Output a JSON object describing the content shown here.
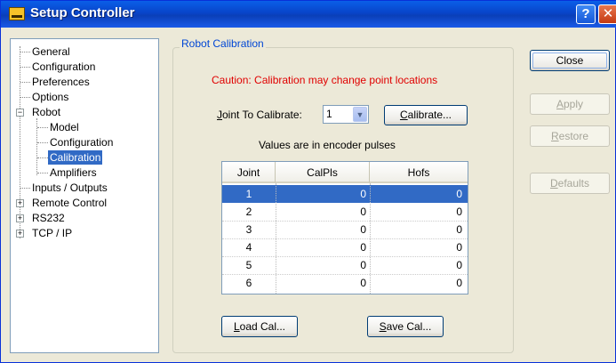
{
  "window": {
    "title": "Setup Controller",
    "help_glyph": "?",
    "close_glyph": "✕"
  },
  "tree": [
    {
      "label": "General",
      "level": 1,
      "selected": false
    },
    {
      "label": "Configuration",
      "level": 1,
      "selected": false
    },
    {
      "label": "Preferences",
      "level": 1,
      "selected": false
    },
    {
      "label": "Options",
      "level": 1,
      "selected": false
    },
    {
      "label": "Robot",
      "level": 1,
      "selected": false,
      "expander": "−"
    },
    {
      "label": "Model",
      "level": 2,
      "selected": false
    },
    {
      "label": "Configuration",
      "level": 2,
      "selected": false
    },
    {
      "label": "Calibration",
      "level": 2,
      "selected": true
    },
    {
      "label": "Amplifiers",
      "level": 2,
      "selected": false
    },
    {
      "label": "Inputs / Outputs",
      "level": 1,
      "selected": false
    },
    {
      "label": "Remote Control",
      "level": 1,
      "selected": false,
      "expander": "+"
    },
    {
      "label": "RS232",
      "level": 1,
      "selected": false,
      "expander": "+"
    },
    {
      "label": "TCP / IP",
      "level": 1,
      "selected": false,
      "expander": "+"
    }
  ],
  "group": {
    "title": "Robot Calibration",
    "caution": "Caution: Calibration may change point locations",
    "joint_label_pre": "",
    "joint_label_key": "J",
    "joint_label_post": "oint To Calibrate:",
    "joint_value": "1",
    "calibrate_key": "C",
    "calibrate_rest": "alibrate...",
    "values_note": "Values are in encoder pulses",
    "load_key": "L",
    "load_rest": "oad Cal...",
    "save_key": "S",
    "save_rest": "ave Cal..."
  },
  "table": {
    "headers": [
      "Joint",
      "CalPls",
      "Hofs"
    ],
    "rows": [
      {
        "joint": "1",
        "calpls": "0",
        "hofs": "0",
        "selected": true
      },
      {
        "joint": "2",
        "calpls": "0",
        "hofs": "0",
        "selected": false
      },
      {
        "joint": "3",
        "calpls": "0",
        "hofs": "0",
        "selected": false
      },
      {
        "joint": "4",
        "calpls": "0",
        "hofs": "0",
        "selected": false
      },
      {
        "joint": "5",
        "calpls": "0",
        "hofs": "0",
        "selected": false
      },
      {
        "joint": "6",
        "calpls": "0",
        "hofs": "0",
        "selected": false
      }
    ]
  },
  "side_buttons": {
    "close": "Close",
    "apply_key": "A",
    "apply_rest": "pply",
    "restore_key": "R",
    "restore_rest": "estore",
    "defaults_key": "D",
    "defaults_rest": "efaults"
  },
  "colors": {
    "title_bar": "#0a5fe8",
    "selection": "#316ac5",
    "caution": "#e00000",
    "group_title": "#0046d5"
  }
}
